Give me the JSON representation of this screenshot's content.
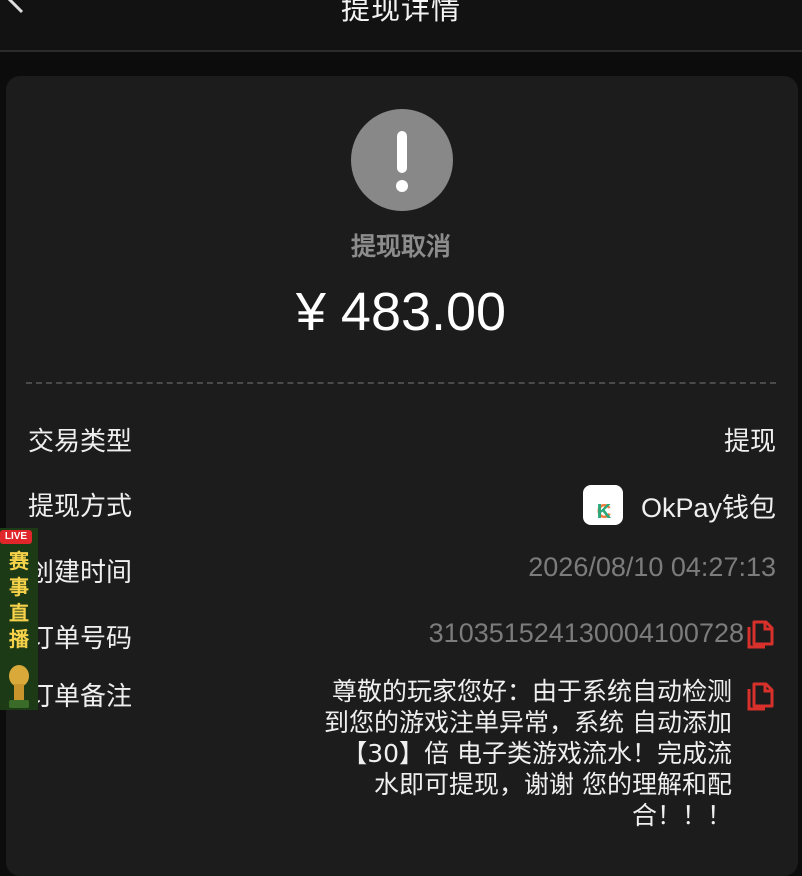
{
  "header": {
    "title": "提现详情",
    "back_icon": "chevron-left-icon"
  },
  "status": {
    "icon": "exclamation-icon",
    "text": "提现取消",
    "color": "#888888"
  },
  "amount": "¥ 483.00",
  "details": {
    "type_label": "交易类型",
    "type_value": "提现",
    "method_label": "提现方式",
    "method_value": "OkPay钱包",
    "method_logo_text": "CK",
    "created_label": "创建时间",
    "created_value": "2026/08/10 04:27:13",
    "order_label": "订单号码",
    "order_value": "310351524130004100728",
    "remark_label": "订单备注",
    "remark_value": "尊敬的玩家您好：由于系统自动检测到您的游戏注单异常，系统 自动添加 【30】倍 电子类游戏流水！完成流水即可提现，谢谢 您的理解和配合！！！"
  },
  "live_banner": {
    "tag": "LIVE",
    "text": "赛事直播"
  },
  "colors": {
    "accent_red": "#d8312b",
    "background": "#1c1c1c"
  }
}
